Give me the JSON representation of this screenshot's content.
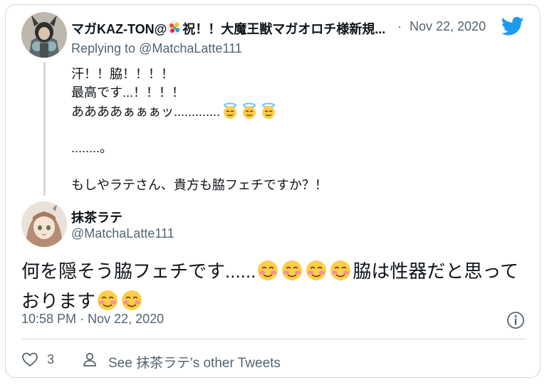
{
  "parent_tweet": {
    "author_name": "マガKAZ-TON@",
    "author_name_rest": "祝！！大魔王獣マガオロチ様新規...",
    "separator": "·",
    "date": "Nov 22, 2020",
    "replying_prefix": "Replying to ",
    "replying_handle": "@MatchaLatte111",
    "lines": [
      "汗！！脇！！！！",
      "最高です...！！！！",
      "ああああぁぁぁッ.............",
      "",
      "........。",
      "",
      "もしやラテさん、貴方も脇フェチですか？！"
    ]
  },
  "reply_tweet": {
    "author_name": "抹茶ラテ",
    "handle": "@MatchaLatte111",
    "text_part1": "何を隠そう脇フェチです......",
    "text_part2": "脇は性器だと思っており",
    "text_part3": "ます",
    "timestamp": "10:58 PM · Nov 22, 2020"
  },
  "actions": {
    "like_count": "3",
    "see_other_tweets": "See 抹茶ラテ's other Tweets"
  },
  "colors": {
    "text_primary": "#0f1419",
    "text_secondary": "#536471",
    "twitter_blue": "#1d9bf0",
    "border": "#cfd9de"
  },
  "icons": {
    "brand": "twitter-bird-icon",
    "info": "info-icon",
    "like": "heart-icon",
    "profile": "person-icon",
    "emoji_halo": "smiling-face-with-halo",
    "emoji_blush": "smiling-face-blush"
  }
}
